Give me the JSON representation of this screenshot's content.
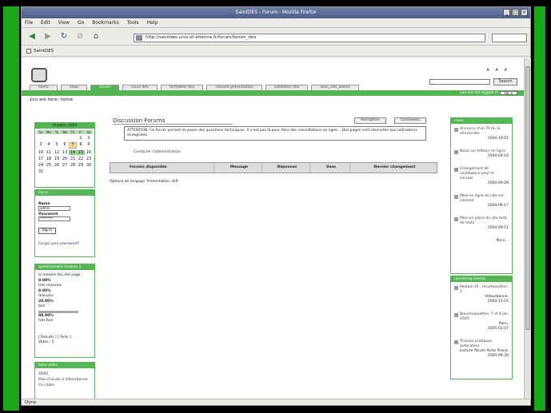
{
  "window": {
    "title": "SaintDES - Forum - Mozilla Firefox",
    "status": "Done"
  },
  "menu": [
    "File",
    "Edit",
    "View",
    "Go",
    "Bookmarks",
    "Tools",
    "Help"
  ],
  "nav": {
    "url": "http://saintdes.univ-st-etienne.fr/forum/forum_dev"
  },
  "bookmarks": [
    "SaintDES"
  ],
  "site": {
    "font_sizes": "A A A",
    "search_button": "Search",
    "tabs": [
      "home",
      "news",
      "forum",
      "cours dev",
      "formation dev",
      "console présentation",
      "validation dev",
      "sous_site_autres"
    ],
    "active_tab_index": 2,
    "login_note": "you are not logged in",
    "login_link": "log in",
    "breadcrumb": "you are here: home"
  },
  "calendar": {
    "title": "October 2004",
    "days_of_week": [
      "Su",
      "Mo",
      "Tu",
      "We",
      "Th",
      "Fr",
      "Sa"
    ],
    "cells": [
      "",
      "",
      "",
      "",
      "",
      "1",
      "2",
      "3",
      "4",
      "5",
      "6",
      "7",
      "8",
      "9",
      "10",
      "11",
      "12",
      "13",
      "14",
      "15",
      "16",
      "17",
      "18",
      "19",
      "20",
      "21",
      "22",
      "23",
      "24",
      "25",
      "26",
      "27",
      "28",
      "29",
      "30",
      "31"
    ],
    "today": "7",
    "selected": [
      "14",
      "15"
    ]
  },
  "login": {
    "title": "log in",
    "name_label": "Name",
    "name_value": "admin",
    "password_label": "Password",
    "password_value": "********",
    "button": "log in",
    "forgot": "Forgot your password?"
  },
  "questionnaire": {
    "title": "questionnaire module 3",
    "intro": "le module fou été page :",
    "rows": [
      {
        "pct": "0.00%",
        "label": "très mauvais"
      },
      {
        "pct": "0.00%",
        "label": "mauvais"
      },
      {
        "pct": "20.00%",
        "label": "bon"
      },
      {
        "pct": "80.00%",
        "label": "très bon"
      }
    ],
    "links": "[ Results ] [ Polls ]",
    "votes": "Votes : 5"
  },
  "liens": {
    "title": "liens utiles",
    "items": [
      "SDRA",
      "Plan d'accès à Villeurbanne",
      "Ce cadre"
    ]
  },
  "main": {
    "title": "Discussion Forums",
    "inscription": "Inscription",
    "connexion": "Connexion",
    "warning": "ATTENTION: Ce forum permet de poser des questions techniques. Il n'est pas là pour faire des consultations en ligne... Des pages sont réservées aux utilisateurs enregistrés.",
    "contact": "Contacter l'administrateur",
    "columns": [
      "Forums disponible",
      "Message",
      "Réponses",
      "Vues",
      "Dernier changement"
    ],
    "options": "Options de langage: Présentation: 8/9"
  },
  "news": {
    "title": "news",
    "items": [
      {
        "title": "Annonce d'un TP de la directorate",
        "date": "2004-10-01"
      },
      {
        "title": "Nous: un éditeur en ligne",
        "date": "2004-09-16"
      },
      {
        "title": "Changement de vestibateur pour le serveur",
        "date": "2004-09-28"
      },
      {
        "title": "Mise en ligne du site sur internet",
        "date": "2004-09-17"
      },
      {
        "title": "Mise en place du site beta de tests",
        "date": "2004-09-11"
      }
    ],
    "more": "More..."
  },
  "events": {
    "title": "upcoming events",
    "items": [
      {
        "title": "Module 10 : recomposition 1",
        "location": "Villeurbanne,",
        "date": "2004-10-15"
      },
      {
        "title": "Nanomaquettes, 7 et 8 jan 2005",
        "location": "Paris,",
        "date": "2005-01-07"
      },
      {
        "title": "Travaux pratiques autocateur",
        "location": "Lecture Atcom Porte Prand,",
        "date": "2005-09-30"
      }
    ]
  }
}
